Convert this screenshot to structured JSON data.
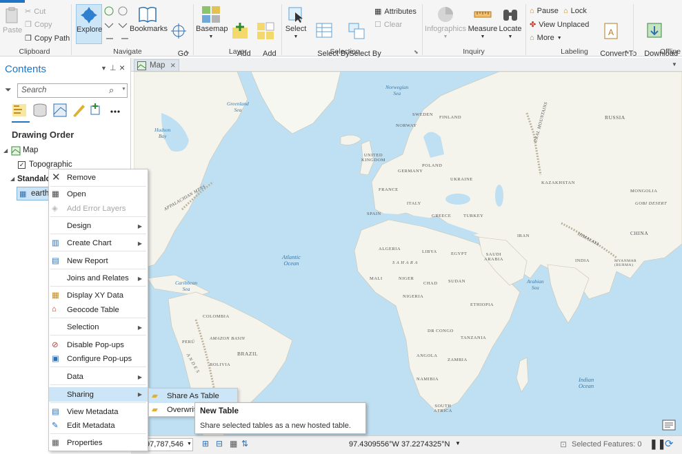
{
  "ribbon": {
    "clipboard": {
      "paste": "Paste",
      "cut": "Cut",
      "copy": "Copy",
      "copy_path": "Copy Path",
      "group": "Clipboard"
    },
    "navigate": {
      "explore": "Explore",
      "bookmarks": "Bookmarks",
      "goto_xy": "Go\nTo XY",
      "group": "Navigate"
    },
    "layer": {
      "basemap": "Basemap",
      "add_data": "Add\nData",
      "add_preset": "Add\nPreset",
      "group": "Layer"
    },
    "selection": {
      "select": "Select",
      "select_by_attributes": "Select By\nAttributes",
      "select_by_location": "Select By\nLocation",
      "attributes": "Attributes",
      "clear": "Clear",
      "group": "Selection"
    },
    "inquiry": {
      "infographics": "Infographics",
      "measure": "Measure",
      "locate": "Locate",
      "group": "Inquiry"
    },
    "labeling": {
      "pause": "Pause",
      "lock": "Lock",
      "view_unplaced": "View Unplaced",
      "more": "More",
      "convert": "Convert To\nAnnotation",
      "group": "Labeling"
    },
    "offline": {
      "download_map": "Download\nMap",
      "group": "Offline"
    }
  },
  "contents": {
    "title": "Contents",
    "search_placeholder": "Search",
    "drawing_order": "Drawing Order",
    "map_label": "Map",
    "topographic": "Topographic",
    "standalone": "Standalone Tables",
    "table_name": "earth"
  },
  "map_tab": {
    "label": "Map"
  },
  "context_menu": {
    "items": [
      "Remove",
      "Open",
      "Add Error Layers",
      "Design",
      "Create Chart",
      "New Report",
      "Joins and Relates",
      "Display XY Data",
      "Geocode Table",
      "Selection",
      "Disable Pop-ups",
      "Configure Pop-ups",
      "Data",
      "Sharing",
      "View Metadata",
      "Edit Metadata",
      "Properties"
    ]
  },
  "submenu": {
    "share_as_table": "Share As Table",
    "overwrite": "Overwrite Table"
  },
  "tooltip": {
    "title": "New Table",
    "body": "Share selected tables as a new hosted table."
  },
  "status": {
    "scale": "97,787,546",
    "coords": "97.4309556°W 37.2274325°N",
    "selected_features": "Selected Features: 0"
  },
  "map_labels": {
    "norwegian_sea": "Norwegian\nSea",
    "greenland_sea": "Greenland\nSea",
    "hudson_bay": "Hudson\nBay",
    "atlantic": "Atlantic\nOcean",
    "indian": "Indian\nOcean",
    "arabian_sea": "Arabian\nSea",
    "caribbean": "Caribbean\nSea",
    "sweden": "SWEDEN",
    "finland": "FINLAND",
    "norway": "NORWAY",
    "russia": "RUSSIA",
    "uk": "UNITED\nKINGDOM",
    "germany": "GERMANY",
    "poland": "POLAND",
    "ukraine": "UKRAINE",
    "france": "FRANCE",
    "italy": "ITALY",
    "spain": "SPAIN",
    "greece": "GREECE",
    "turkey": "TURKEY",
    "kazakhstan": "KAZAKHSTAN",
    "mongolia": "MONGOLIA",
    "gobi": "GOBI DESERT",
    "china": "CHINA",
    "iran": "IRAN",
    "india": "INDIA",
    "myanmar": "MYANMAR\n(BURMA)",
    "himalaya": "HIMALAYA",
    "ural": "URAL MOUNTAINS",
    "algeria": "ALGERIA",
    "libya": "LIBYA",
    "egypt": "EGYPT",
    "sahara": "S A H A R A",
    "saudi": "SAUDI\nARABIA",
    "mali": "MALI",
    "niger": "NIGER",
    "chad": "CHAD",
    "sudan": "SUDAN",
    "nigeria": "NIGERIA",
    "ethiopia": "ETHIOPIA",
    "drc": "DR CONGO",
    "tanzania": "TANZANIA",
    "angola": "ANGOLA",
    "zambia": "ZAMBIA",
    "namibia": "NAMIBIA",
    "south_africa": "SOUTH\nAFRICA",
    "colombia": "COLOMBIA",
    "peru": "PERÚ",
    "brazil": "BRAZIL",
    "amazon": "AMAZON BASIN",
    "bolivia": "BOLIVIA",
    "andes": "A N D E S",
    "appalachian": "APPALACHIAN MTNS"
  },
  "colors": {
    "accent": "#1f75c4",
    "land": "#f4f3ec",
    "water": "#bfe0f2",
    "highlight": "#cde6f7",
    "selected_row": "#cce4f7"
  }
}
